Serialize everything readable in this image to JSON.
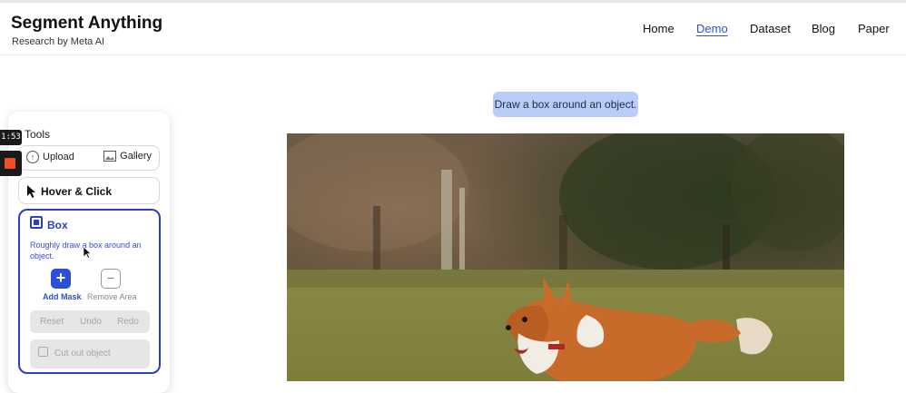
{
  "header": {
    "title": "Segment Anything",
    "subtitle": "Research by Meta AI",
    "nav": [
      {
        "label": "Home"
      },
      {
        "label": "Demo",
        "active": true
      },
      {
        "label": "Dataset"
      },
      {
        "label": "Blog"
      },
      {
        "label": "Paper"
      }
    ]
  },
  "prompt": {
    "text": "Draw a box around an object."
  },
  "tools": {
    "label": "Tools",
    "upload_label": "Upload",
    "gallery_label": "Gallery",
    "hover_click_label": "Hover & Click",
    "box": {
      "title": "Box",
      "description": "Roughly draw a box around an object.",
      "add_mask_label": "Add Mask",
      "remove_area_label": "Remove Area",
      "actions": [
        "Reset",
        "Undo",
        "Redo"
      ],
      "cutout_label": "Cut out object"
    }
  },
  "recorder": {
    "time": "1:53"
  },
  "colors": {
    "accent": "#2c4fd6",
    "prompt_bg": "#b9cdf8",
    "record": "#f04e23"
  }
}
